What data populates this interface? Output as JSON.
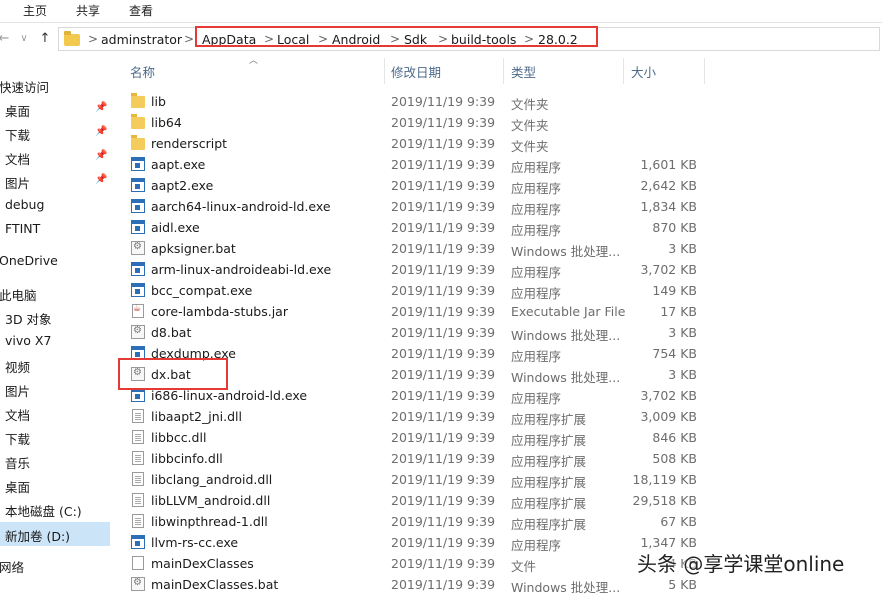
{
  "ribbon": {
    "tabs": [
      "主页",
      "共享",
      "查看"
    ]
  },
  "address": {
    "breadcrumbs": [
      "adminstrator",
      "AppData",
      "Local",
      "Android",
      "Sdk",
      "build-tools",
      "28.0.2"
    ],
    "separator": ">"
  },
  "sidebar": {
    "items": [
      {
        "label": "快速访问",
        "icon": "star-icon"
      },
      {
        "label": "桌面",
        "icon": "desktop-icon",
        "pinned": true
      },
      {
        "label": "下载",
        "icon": "download-icon",
        "pinned": true
      },
      {
        "label": "文档",
        "icon": "document-icon",
        "pinned": true
      },
      {
        "label": "图片",
        "icon": "picture-icon",
        "pinned": true
      },
      {
        "label": "debug",
        "icon": "folder-icon"
      },
      {
        "label": "FTINT",
        "icon": "folder-icon"
      },
      {
        "label": "OneDrive",
        "icon": "cloud-icon"
      },
      {
        "label": "此电脑",
        "icon": "computer-icon"
      },
      {
        "label": "3D 对象",
        "icon": "cube-icon"
      },
      {
        "label": "vivo X7",
        "icon": "phone-icon"
      },
      {
        "label": "视频",
        "icon": "video-icon"
      },
      {
        "label": "图片",
        "icon": "picture-icon"
      },
      {
        "label": "文档",
        "icon": "document-icon"
      },
      {
        "label": "下载",
        "icon": "download-icon"
      },
      {
        "label": "音乐",
        "icon": "music-icon"
      },
      {
        "label": "桌面",
        "icon": "desktop-icon"
      },
      {
        "label": "本地磁盘 (C:)",
        "icon": "drive-icon"
      },
      {
        "label": "新加卷 (D:)",
        "icon": "drive-icon",
        "selected": true
      },
      {
        "label": "网络",
        "icon": "network-icon"
      }
    ]
  },
  "columns": {
    "name": "名称",
    "date": "修改日期",
    "type": "类型",
    "size": "大小"
  },
  "files": [
    {
      "name": "lib",
      "date": "2019/11/19 9:39",
      "type": "文件夹",
      "size": "",
      "icon": "folder"
    },
    {
      "name": "lib64",
      "date": "2019/11/19 9:39",
      "type": "文件夹",
      "size": "",
      "icon": "folder"
    },
    {
      "name": "renderscript",
      "date": "2019/11/19 9:39",
      "type": "文件夹",
      "size": "",
      "icon": "folder"
    },
    {
      "name": "aapt.exe",
      "date": "2019/11/19 9:39",
      "type": "应用程序",
      "size": "1,601 KB",
      "icon": "exe"
    },
    {
      "name": "aapt2.exe",
      "date": "2019/11/19 9:39",
      "type": "应用程序",
      "size": "2,642 KB",
      "icon": "exe"
    },
    {
      "name": "aarch64-linux-android-ld.exe",
      "date": "2019/11/19 9:39",
      "type": "应用程序",
      "size": "1,834 KB",
      "icon": "exe"
    },
    {
      "name": "aidl.exe",
      "date": "2019/11/19 9:39",
      "type": "应用程序",
      "size": "870 KB",
      "icon": "exe"
    },
    {
      "name": "apksigner.bat",
      "date": "2019/11/19 9:39",
      "type": "Windows 批处理...",
      "size": "3 KB",
      "icon": "bat"
    },
    {
      "name": "arm-linux-androideabi-ld.exe",
      "date": "2019/11/19 9:39",
      "type": "应用程序",
      "size": "3,702 KB",
      "icon": "exe"
    },
    {
      "name": "bcc_compat.exe",
      "date": "2019/11/19 9:39",
      "type": "应用程序",
      "size": "149 KB",
      "icon": "exe"
    },
    {
      "name": "core-lambda-stubs.jar",
      "date": "2019/11/19 9:39",
      "type": "Executable Jar File",
      "size": "17 KB",
      "icon": "jar"
    },
    {
      "name": "d8.bat",
      "date": "2019/11/19 9:39",
      "type": "Windows 批处理...",
      "size": "3 KB",
      "icon": "bat"
    },
    {
      "name": "dexdump.exe",
      "date": "2019/11/19 9:39",
      "type": "应用程序",
      "size": "754 KB",
      "icon": "exe"
    },
    {
      "name": "dx.bat",
      "date": "2019/11/19 9:39",
      "type": "Windows 批处理...",
      "size": "3 KB",
      "icon": "bat"
    },
    {
      "name": "i686-linux-android-ld.exe",
      "date": "2019/11/19 9:39",
      "type": "应用程序",
      "size": "3,702 KB",
      "icon": "exe"
    },
    {
      "name": "libaapt2_jni.dll",
      "date": "2019/11/19 9:39",
      "type": "应用程序扩展",
      "size": "3,009 KB",
      "icon": "dll"
    },
    {
      "name": "libbcc.dll",
      "date": "2019/11/19 9:39",
      "type": "应用程序扩展",
      "size": "846 KB",
      "icon": "dll"
    },
    {
      "name": "libbcinfo.dll",
      "date": "2019/11/19 9:39",
      "type": "应用程序扩展",
      "size": "508 KB",
      "icon": "dll"
    },
    {
      "name": "libclang_android.dll",
      "date": "2019/11/19 9:39",
      "type": "应用程序扩展",
      "size": "18,119 KB",
      "icon": "dll"
    },
    {
      "name": "libLLVM_android.dll",
      "date": "2019/11/19 9:39",
      "type": "应用程序扩展",
      "size": "29,518 KB",
      "icon": "dll"
    },
    {
      "name": "libwinpthread-1.dll",
      "date": "2019/11/19 9:39",
      "type": "应用程序扩展",
      "size": "67 KB",
      "icon": "dll"
    },
    {
      "name": "llvm-rs-cc.exe",
      "date": "2019/11/19 9:39",
      "type": "应用程序",
      "size": "1,347 KB",
      "icon": "exe"
    },
    {
      "name": "mainDexClasses",
      "date": "2019/11/19 9:39",
      "type": "文件",
      "size": "4 KB",
      "icon": "file"
    },
    {
      "name": "mainDexClasses.bat",
      "date": "2019/11/19 9:39",
      "type": "Windows 批处理...",
      "size": "5 KB",
      "icon": "bat"
    }
  ],
  "watermark": "头条 @享学课堂online",
  "colors": {
    "highlight_frame": "#e53935",
    "selection": "#cce4f7",
    "folder": "#f4cc5b"
  }
}
